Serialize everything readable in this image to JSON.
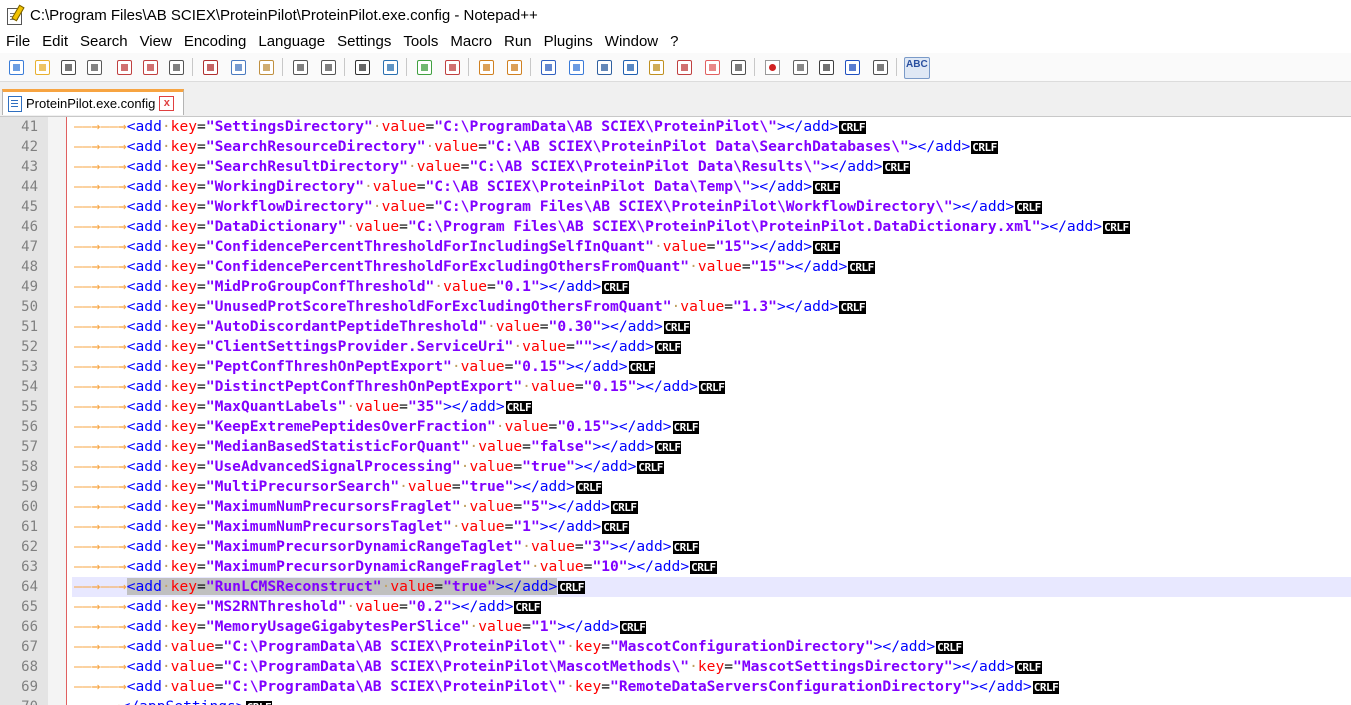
{
  "window": {
    "title": "C:\\Program Files\\AB SCIEX\\ProteinPilot\\ProteinPilot.exe.config - Notepad++"
  },
  "menu": [
    "File",
    "Edit",
    "Search",
    "View",
    "Encoding",
    "Language",
    "Settings",
    "Tools",
    "Macro",
    "Run",
    "Plugins",
    "Window",
    "?"
  ],
  "toolbar": {
    "icons": [
      "new-file-icon",
      "open-file-icon",
      "save-icon",
      "save-all-icon",
      "close-icon",
      "close-all-icon",
      "print-icon",
      "cut-icon",
      "copy-icon",
      "paste-icon",
      "undo-icon",
      "redo-icon",
      "find-icon",
      "replace-icon",
      "zoom-in-icon",
      "zoom-out-icon",
      "sync-vertical-icon",
      "sync-horizontal-icon",
      "word-wrap-icon",
      "show-all-chars-icon",
      "indent-guide-icon",
      "user-defined-lang-icon",
      "doc-map-icon",
      "function-list-icon",
      "folder-workspace-icon",
      "monitoring-icon",
      "record-macro-icon",
      "stop-macro-icon",
      "play-macro-icon",
      "run-macro-multiple-icon",
      "save-macro-icon",
      "spell-check-icon"
    ],
    "spellcheck_label": "ABC"
  },
  "tab": {
    "label": "ProteinPilot.exe.config",
    "close": "x"
  },
  "colors": {
    "accent": "#f7a441",
    "tag": "#0000ff",
    "attr": "#ff0000",
    "value": "#8000ff",
    "current_line": "#e8e8ff"
  },
  "crlf": "CRLF",
  "current_line": 64,
  "lines": [
    {
      "n": "41",
      "attrs": [
        [
          "key",
          "\"SettingsDirectory\""
        ],
        [
          "value",
          "\"C:\\ProgramData\\AB SCIEX\\ProteinPilot\\\""
        ]
      ]
    },
    {
      "n": "42",
      "attrs": [
        [
          "key",
          "\"SearchResourceDirectory\""
        ],
        [
          "value",
          "\"C:\\AB SCIEX\\ProteinPilot Data\\SearchDatabases\\\""
        ]
      ]
    },
    {
      "n": "43",
      "attrs": [
        [
          "key",
          "\"SearchResultDirectory\""
        ],
        [
          "value",
          "\"C:\\AB SCIEX\\ProteinPilot Data\\Results\\\""
        ]
      ]
    },
    {
      "n": "44",
      "attrs": [
        [
          "key",
          "\"WorkingDirectory\""
        ],
        [
          "value",
          "\"C:\\AB SCIEX\\ProteinPilot Data\\Temp\\\""
        ]
      ]
    },
    {
      "n": "45",
      "attrs": [
        [
          "key",
          "\"WorkflowDirectory\""
        ],
        [
          "value",
          "\"C:\\Program Files\\AB SCIEX\\ProteinPilot\\WorkflowDirectory\\\""
        ]
      ]
    },
    {
      "n": "46",
      "attrs": [
        [
          "key",
          "\"DataDictionary\""
        ],
        [
          "value",
          "\"C:\\Program Files\\AB SCIEX\\ProteinPilot\\ProteinPilot.DataDictionary.xml\""
        ]
      ]
    },
    {
      "n": "47",
      "attrs": [
        [
          "key",
          "\"ConfidencePercentThresholdForIncludingSelfInQuant\""
        ],
        [
          "value",
          "\"15\""
        ]
      ]
    },
    {
      "n": "48",
      "attrs": [
        [
          "key",
          "\"ConfidencePercentThresholdForExcludingOthersFromQuant\""
        ],
        [
          "value",
          "\"15\""
        ]
      ]
    },
    {
      "n": "49",
      "attrs": [
        [
          "key",
          "\"MidProGroupConfThreshold\""
        ],
        [
          "value",
          "\"0.1\""
        ]
      ]
    },
    {
      "n": "50",
      "attrs": [
        [
          "key",
          "\"UnusedProtScoreThresholdForExcludingOthersFromQuant\""
        ],
        [
          "value",
          "\"1.3\""
        ]
      ]
    },
    {
      "n": "51",
      "attrs": [
        [
          "key",
          "\"AutoDiscordantPeptideThreshold\""
        ],
        [
          "value",
          "\"0.30\""
        ]
      ]
    },
    {
      "n": "52",
      "attrs": [
        [
          "key",
          "\"ClientSettingsProvider.ServiceUri\""
        ],
        [
          "value",
          "\"\""
        ]
      ]
    },
    {
      "n": "53",
      "attrs": [
        [
          "key",
          "\"PeptConfThreshOnPeptExport\""
        ],
        [
          "value",
          "\"0.15\""
        ]
      ]
    },
    {
      "n": "54",
      "attrs": [
        [
          "key",
          "\"DistinctPeptConfThreshOnPeptExport\""
        ],
        [
          "value",
          "\"0.15\""
        ]
      ]
    },
    {
      "n": "55",
      "attrs": [
        [
          "key",
          "\"MaxQuantLabels\""
        ],
        [
          "value",
          "\"35\""
        ]
      ]
    },
    {
      "n": "56",
      "attrs": [
        [
          "key",
          "\"KeepExtremePeptidesOverFraction\""
        ],
        [
          "value",
          "\"0.15\""
        ]
      ]
    },
    {
      "n": "57",
      "attrs": [
        [
          "key",
          "\"MedianBasedStatisticForQuant\""
        ],
        [
          "value",
          "\"false\""
        ]
      ]
    },
    {
      "n": "58",
      "attrs": [
        [
          "key",
          "\"UseAdvancedSignalProcessing\""
        ],
        [
          "value",
          "\"true\""
        ]
      ]
    },
    {
      "n": "59",
      "attrs": [
        [
          "key",
          "\"MultiPrecursorSearch\""
        ],
        [
          "value",
          "\"true\""
        ]
      ]
    },
    {
      "n": "60",
      "attrs": [
        [
          "key",
          "\"MaximumNumPrecursorsFraglet\""
        ],
        [
          "value",
          "\"5\""
        ]
      ]
    },
    {
      "n": "61",
      "attrs": [
        [
          "key",
          "\"MaximumNumPrecursorsTaglet\""
        ],
        [
          "value",
          "\"1\""
        ]
      ]
    },
    {
      "n": "62",
      "attrs": [
        [
          "key",
          "\"MaximumPrecursorDynamicRangeTaglet\""
        ],
        [
          "value",
          "\"3\""
        ]
      ]
    },
    {
      "n": "63",
      "attrs": [
        [
          "key",
          "\"MaximumPrecursorDynamicRangeFraglet\""
        ],
        [
          "value",
          "\"10\""
        ]
      ]
    },
    {
      "n": "64",
      "attrs": [
        [
          "key",
          "\"RunLCMSReconstruct\""
        ],
        [
          "value",
          "\"true\""
        ]
      ]
    },
    {
      "n": "65",
      "attrs": [
        [
          "key",
          "\"MS2RNThreshold\""
        ],
        [
          "value",
          "\"0.2\""
        ]
      ]
    },
    {
      "n": "66",
      "attrs": [
        [
          "key",
          "\"MemoryUsageGigabytesPerSlice\""
        ],
        [
          "value",
          "\"1\""
        ]
      ]
    },
    {
      "n": "67",
      "attrs": [
        [
          "value",
          "\"C:\\ProgramData\\AB SCIEX\\ProteinPilot\\\""
        ],
        [
          "key",
          "\"MascotConfigurationDirectory\""
        ]
      ]
    },
    {
      "n": "68",
      "attrs": [
        [
          "value",
          "\"C:\\ProgramData\\AB SCIEX\\ProteinPilot\\MascotMethods\\\""
        ],
        [
          "key",
          "\"MascotSettingsDirectory\""
        ]
      ]
    },
    {
      "n": "69",
      "attrs": [
        [
          "value",
          "\"C:\\ProgramData\\AB SCIEX\\ProteinPilot\\\""
        ],
        [
          "key",
          "\"RemoteDataServersConfigurationDirectory\""
        ]
      ]
    }
  ],
  "tail_line": {
    "n": "70",
    "text": "</appSettings>"
  }
}
